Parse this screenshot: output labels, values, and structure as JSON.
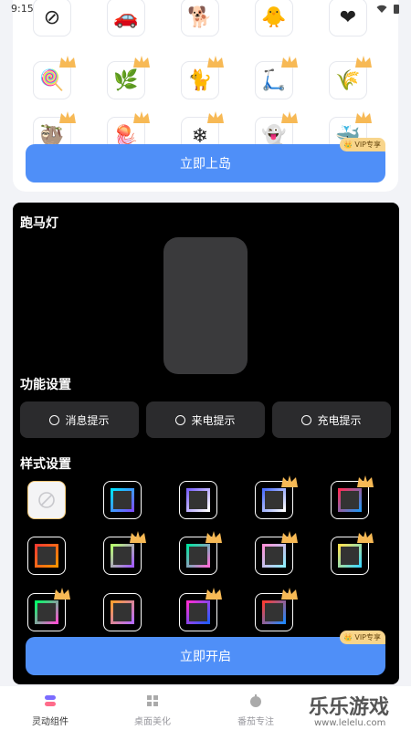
{
  "status_bar": {
    "time": "9:15"
  },
  "island": {
    "icons": [
      {
        "name": "disabled-icon",
        "glyph": "⊘"
      },
      {
        "name": "car-icon",
        "glyph": "🚗"
      },
      {
        "name": "dog-icon",
        "glyph": "🐕"
      },
      {
        "name": "chick-icon",
        "glyph": "🐥"
      },
      {
        "name": "heart-icon",
        "glyph": "❤"
      },
      {
        "name": "lollipop-icon",
        "glyph": "🍭"
      },
      {
        "name": "grass-icon",
        "glyph": "🌿"
      },
      {
        "name": "black-cat-icon",
        "glyph": "🐈"
      },
      {
        "name": "scooter-icon",
        "glyph": "🛴"
      },
      {
        "name": "willow-icon",
        "glyph": "🌾"
      },
      {
        "name": "sloth-icon",
        "glyph": "🦥"
      },
      {
        "name": "jellyfish-icon",
        "glyph": "🪼"
      },
      {
        "name": "snowflake-icon",
        "glyph": "❄"
      },
      {
        "name": "ghost-icon",
        "glyph": "👻"
      },
      {
        "name": "whale-icon",
        "glyph": "🐳"
      }
    ],
    "start_button": "立即上岛",
    "vip_label": "VIP专享"
  },
  "marquee": {
    "title": "跑马灯",
    "function_title": "功能设置",
    "function_options": [
      "消息提示",
      "来电提示",
      "充电提示"
    ],
    "style_title": "样式设置",
    "start_button": "立即开启",
    "vip_label": "VIP专享",
    "style_gradients": [
      [
        "#00e5ff",
        "#7c4dff"
      ],
      [
        "#7b61ff",
        "#ffffff"
      ],
      [
        "#4a6cff",
        "#ffffff"
      ],
      [
        "#ff2d55",
        "#2196f3"
      ],
      [
        "#ff3b30",
        "#ff9500"
      ],
      [
        "#b6ff6b",
        "#a259ff"
      ],
      [
        "#00e5a0",
        "#ff6bd6"
      ],
      [
        "#ff8fd6",
        "#8ef0ff"
      ],
      [
        "#ffe14d",
        "#3dd8ff"
      ],
      [
        "#00ff66",
        "#ff4dd2"
      ],
      [
        "#ff9f2e",
        "#b56bff"
      ],
      [
        "#ff2dd2",
        "#1e5bff"
      ],
      [
        "#ff3b30",
        "#1e88ff"
      ]
    ]
  },
  "nav": {
    "items": [
      {
        "label": "灵动组件",
        "active": true
      },
      {
        "label": "桌面美化",
        "active": false
      },
      {
        "label": "番茄专注",
        "active": false
      }
    ]
  },
  "watermark": {
    "text": "乐乐游戏",
    "url": "www.lelelu.com"
  },
  "colors": {
    "primary": "#4f8ff8",
    "vip": "#f8d58c"
  }
}
